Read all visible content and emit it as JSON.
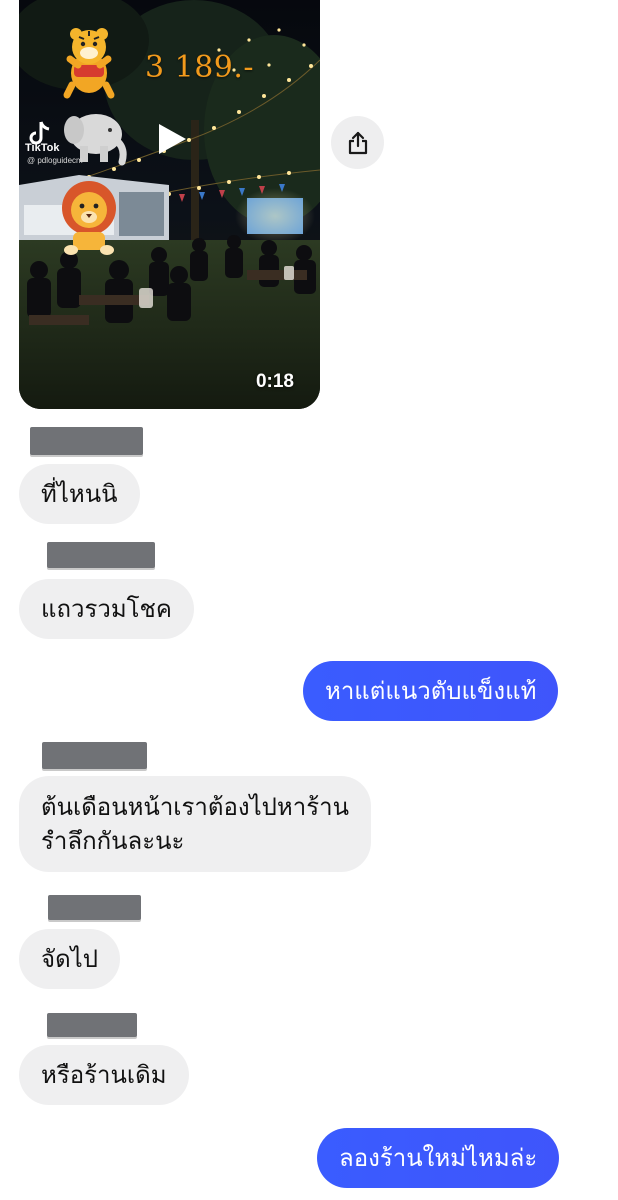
{
  "video": {
    "price_text": "3 189.-",
    "tiktok_label": "TikTok",
    "tiktok_handle": "@ pdloguidecm",
    "duration": "0:18",
    "play_icon": "play-icon",
    "share_icon": "share-icon"
  },
  "messages": [
    {
      "sender_name": "██████",
      "text": "ที่ไหนนิ",
      "direction": "received"
    },
    {
      "sender_name": "██████",
      "text": "แถวรวมโชค",
      "direction": "received"
    },
    {
      "text": "หาแต่แนวตับแข็งแท้",
      "direction": "sent"
    },
    {
      "sender_name": "██████",
      "lines": [
        "ต้นเดือนหน้าเราต้องไปหาร้าน",
        "รำลึกกันละนะ"
      ],
      "direction": "received"
    },
    {
      "sender_name": "██████",
      "text": "จัดไป",
      "direction": "received"
    },
    {
      "sender_name": "██████",
      "text": "หรือร้านเดิม",
      "direction": "received"
    },
    {
      "text": "ลองร้านใหม่ไหมล่ะ",
      "direction": "sent"
    }
  ],
  "colors": {
    "sent_bubble": "#3d5afe",
    "received_bubble": "#efeff0",
    "redaction": "#707276"
  }
}
